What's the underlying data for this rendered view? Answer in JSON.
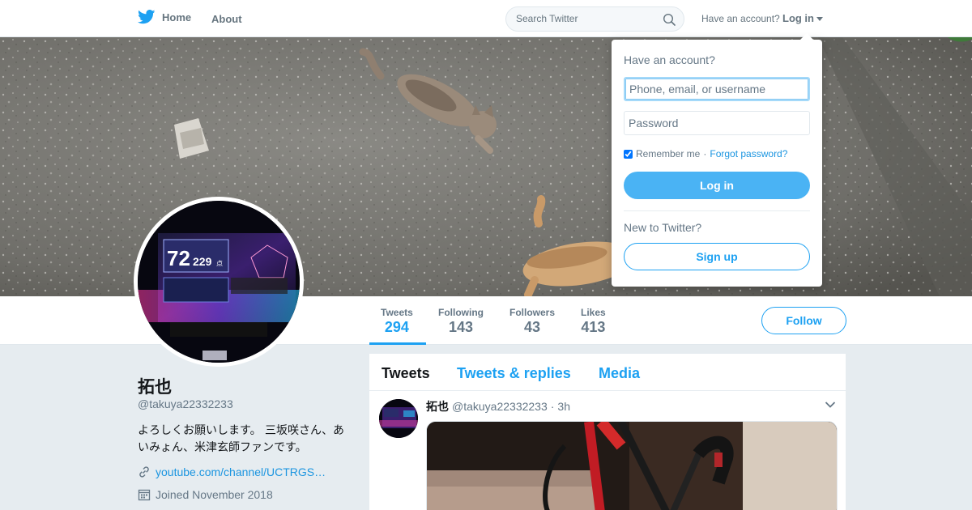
{
  "nav": {
    "home_label": "Home",
    "about_label": "About",
    "search_placeholder": "Search Twitter",
    "login_prompt": "Have an account?",
    "login_label": "Log in",
    "brand_color": "#1da1f2"
  },
  "profile": {
    "name": "拓也",
    "handle": "@takuya22332233",
    "bio": "よろしくお願いします。 三坂咲さん、あいみょん、米津玄師ファンです。",
    "link": "youtube.com/channel/UCTRGS…",
    "joined": "Joined November 2018",
    "follow_label": "Follow",
    "stats": [
      {
        "label": "Tweets",
        "value": "294"
      },
      {
        "label": "Following",
        "value": "143"
      },
      {
        "label": "Followers",
        "value": "43"
      },
      {
        "label": "Likes",
        "value": "413"
      }
    ]
  },
  "timeline": {
    "tabs": [
      {
        "label": "Tweets"
      },
      {
        "label": "Tweets & replies"
      },
      {
        "label": "Media"
      }
    ],
    "tweet": {
      "name": "拓也",
      "handle": "@takuya22332233",
      "separator": "·",
      "time": "3h"
    }
  },
  "avatar_image": {
    "score_big": "72",
    "score_small": "229",
    "score_unit": "点"
  },
  "login_dropdown": {
    "title": "Have an account?",
    "username_placeholder": "Phone, email, or username",
    "password_placeholder": "Password",
    "remember_label": "Remember me",
    "separator": "·",
    "forgot_label": "Forgot password?",
    "login_button": "Log in",
    "new_prompt": "New to Twitter?",
    "signup_button": "Sign up"
  },
  "icons": {
    "logo": "twitter-bird-icon",
    "search": "search-icon",
    "link": "link-icon",
    "calendar": "calendar-icon",
    "tweet_menu": "chevron-down-icon"
  }
}
